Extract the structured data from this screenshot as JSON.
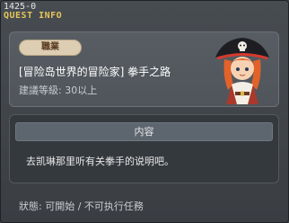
{
  "window": {
    "quest_id": "1425-0",
    "title": "QUEST INFO"
  },
  "quest": {
    "category": "職業",
    "name": "[冒险岛世界的冒险家] 拳手之路",
    "level_requirement": "建議等級: 30以上",
    "npc_portrait": "pirate-npc-portrait"
  },
  "content": {
    "header": "内容",
    "description": "去凯琳那里听有关拳手的说明吧。"
  },
  "status": "狀態: 可開始 / 不可执行任務",
  "colors": {
    "title_gold": "#e7c45a",
    "badge_bg": "#dccdb3",
    "window_bg": "#474c51"
  }
}
